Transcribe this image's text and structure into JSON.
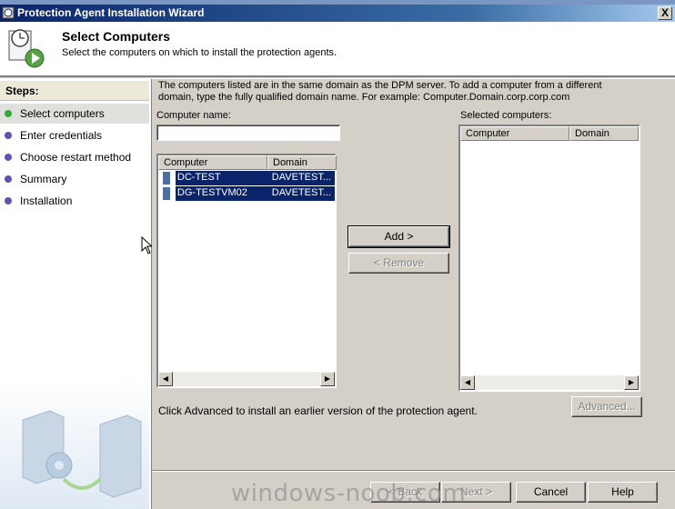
{
  "window": {
    "title": "Protection Agent Installation Wizard",
    "close_label": "X"
  },
  "header": {
    "title": "Select Computers",
    "subtitle": "Select the computers on which to install the protection agents."
  },
  "steps": {
    "heading": "Steps:",
    "items": [
      {
        "label": "Select computers",
        "active": true
      },
      {
        "label": "Enter credentials",
        "active": false
      },
      {
        "label": "Choose restart method",
        "active": false
      },
      {
        "label": "Summary",
        "active": false
      },
      {
        "label": "Installation",
        "active": false
      }
    ]
  },
  "main": {
    "description": "The computers listed are in the same domain as the DPM server. To add a computer from a different domain, type the fully qualified domain name. For example: Computer.Domain.corp.corp.com",
    "computer_name_label": "Computer name:",
    "computer_name_value": "",
    "available": {
      "columns": [
        "Computer",
        "Domain"
      ],
      "rows": [
        {
          "computer": "DC-TEST",
          "domain": "DAVETEST...",
          "selected": true
        },
        {
          "computer": "DG-TESTVM02",
          "domain": "DAVETEST...",
          "selected": true
        }
      ]
    },
    "add_button": "Add >",
    "remove_button": "< Remove",
    "selected_label": "Selected computers:",
    "selected": {
      "columns": [
        "Computer",
        "Domain"
      ],
      "rows": []
    },
    "advanced_text": "Click Advanced to install an earlier version of the protection agent.",
    "advanced_button": "Advanced..."
  },
  "footer": {
    "back_button": "< Back",
    "next_button": "Next >",
    "cancel_button": "Cancel",
    "help_button": "Help"
  },
  "watermark": "windows-noob.com",
  "colors": {
    "selection": "#0a246a",
    "active_dot": "#3aa53a",
    "dot": "#5a55b0",
    "titlebar": "#0a246a"
  }
}
